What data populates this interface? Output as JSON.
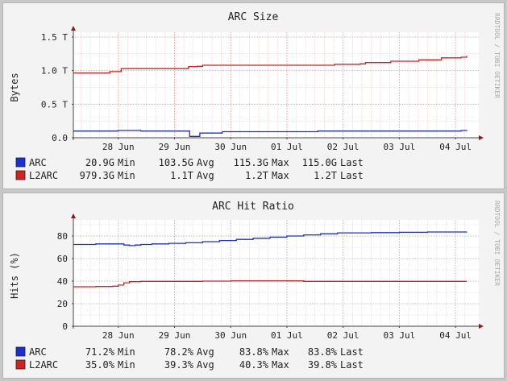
{
  "watermark": "RRDTOOL / TOBI OETIKER",
  "chart_data": [
    {
      "type": "line",
      "title": "ARC Size",
      "ylabel": "Bytes",
      "yticks": [
        {
          "value": 0.0,
          "label": "0.0"
        },
        {
          "value": 0.5,
          "label": "0.5 T"
        },
        {
          "value": 1.0,
          "label": "1.0 T"
        },
        {
          "value": 1.5,
          "label": "1.5 T"
        }
      ],
      "ylim": [
        0,
        1.5
      ],
      "grid": true,
      "xlim": [
        27.2,
        34.3
      ],
      "xticks": [
        {
          "value": 28,
          "label": "28 Jun"
        },
        {
          "value": 29,
          "label": "29 Jun"
        },
        {
          "value": 30,
          "label": "30 Jun"
        },
        {
          "value": 31,
          "label": "01 Jul"
        },
        {
          "value": 32,
          "label": "02 Jul"
        },
        {
          "value": 33,
          "label": "03 Jul"
        },
        {
          "value": 34,
          "label": "04 Jul"
        }
      ],
      "series": [
        {
          "name": "ARC",
          "color": "#1a2fd8",
          "stats": {
            "min": "20.9G",
            "avg": "103.5G",
            "max": "115.3G",
            "last": "115.0G"
          },
          "points": [
            [
              27.2,
              0.1
            ],
            [
              27.9,
              0.1
            ],
            [
              28.0,
              0.108
            ],
            [
              28.3,
              0.108
            ],
            [
              28.4,
              0.1
            ],
            [
              29.25,
              0.1
            ],
            [
              29.27,
              0.021
            ],
            [
              29.4,
              0.021
            ],
            [
              29.45,
              0.07
            ],
            [
              29.8,
              0.07
            ],
            [
              29.85,
              0.09
            ],
            [
              31.5,
              0.09
            ],
            [
              31.55,
              0.1
            ],
            [
              33.8,
              0.1
            ],
            [
              34.1,
              0.108
            ],
            [
              34.2,
              0.1
            ]
          ]
        },
        {
          "name": "L2ARC",
          "color": "#d42020",
          "stats": {
            "min": "979.3G",
            "avg": "1.1T",
            "max": "1.2T",
            "last": "1.2T"
          },
          "points": [
            [
              27.2,
              0.965
            ],
            [
              27.8,
              0.965
            ],
            [
              27.85,
              0.985
            ],
            [
              28.0,
              0.985
            ],
            [
              28.05,
              1.03
            ],
            [
              29.2,
              1.03
            ],
            [
              29.25,
              1.06
            ],
            [
              29.4,
              1.065
            ],
            [
              29.5,
              1.08
            ],
            [
              31.8,
              1.08
            ],
            [
              31.85,
              1.095
            ],
            [
              32.3,
              1.1
            ],
            [
              32.4,
              1.12
            ],
            [
              32.8,
              1.12
            ],
            [
              32.85,
              1.14
            ],
            [
              33.3,
              1.14
            ],
            [
              33.35,
              1.16
            ],
            [
              33.7,
              1.16
            ],
            [
              33.75,
              1.19
            ],
            [
              34.1,
              1.2
            ],
            [
              34.2,
              1.22
            ]
          ]
        }
      ]
    },
    {
      "type": "line",
      "title": "ARC Hit Ratio",
      "ylabel": "Hits (%)",
      "yticks": [
        {
          "value": 0,
          "label": "0"
        },
        {
          "value": 20,
          "label": "20"
        },
        {
          "value": 40,
          "label": "40"
        },
        {
          "value": 60,
          "label": "60"
        },
        {
          "value": 80,
          "label": "80"
        }
      ],
      "ylim": [
        0,
        90
      ],
      "grid": true,
      "xlim": [
        27.2,
        34.3
      ],
      "xticks": [
        {
          "value": 28,
          "label": "28 Jun"
        },
        {
          "value": 29,
          "label": "29 Jun"
        },
        {
          "value": 30,
          "label": "30 Jun"
        },
        {
          "value": 31,
          "label": "01 Jul"
        },
        {
          "value": 32,
          "label": "02 Jul"
        },
        {
          "value": 33,
          "label": "03 Jul"
        },
        {
          "value": 34,
          "label": "04 Jul"
        }
      ],
      "series": [
        {
          "name": "ARC",
          "color": "#1a2fd8",
          "stats": {
            "min": "71.2%",
            "avg": "78.2%",
            "max": "83.8%",
            "last": "83.8%"
          },
          "points": [
            [
              27.2,
              72.5
            ],
            [
              27.6,
              73.0
            ],
            [
              28.0,
              73.0
            ],
            [
              28.1,
              72.0
            ],
            [
              28.2,
              71.5
            ],
            [
              28.3,
              72.0
            ],
            [
              28.4,
              72.5
            ],
            [
              28.6,
              73.0
            ],
            [
              28.9,
              73.5
            ],
            [
              29.2,
              74.0
            ],
            [
              29.5,
              75.0
            ],
            [
              29.8,
              76.0
            ],
            [
              30.1,
              77.0
            ],
            [
              30.4,
              78.0
            ],
            [
              30.7,
              79.0
            ],
            [
              31.0,
              80.0
            ],
            [
              31.3,
              81.0
            ],
            [
              31.6,
              82.0
            ],
            [
              31.9,
              82.8
            ],
            [
              32.5,
              83.0
            ],
            [
              33.0,
              83.3
            ],
            [
              33.5,
              83.6
            ],
            [
              34.2,
              83.8
            ]
          ]
        },
        {
          "name": "L2ARC",
          "color": "#d42020",
          "stats": {
            "min": "35.0%",
            "avg": "39.3%",
            "max": "40.3%",
            "last": "39.8%"
          },
          "points": [
            [
              27.2,
              35.0
            ],
            [
              27.6,
              35.2
            ],
            [
              27.9,
              35.5
            ],
            [
              28.0,
              36.5
            ],
            [
              28.1,
              38.5
            ],
            [
              28.2,
              39.5
            ],
            [
              28.4,
              39.8
            ],
            [
              29.5,
              40.0
            ],
            [
              30.0,
              40.3
            ],
            [
              31.0,
              40.2
            ],
            [
              31.3,
              39.8
            ],
            [
              34.2,
              39.8
            ]
          ]
        }
      ]
    }
  ]
}
